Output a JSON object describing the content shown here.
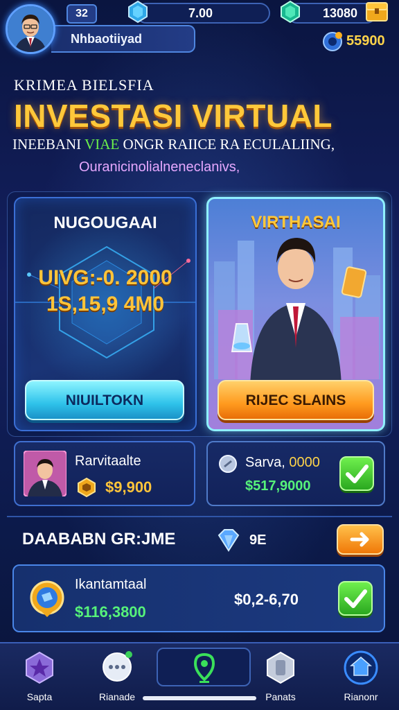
{
  "player": {
    "name": "Nhbaotiiyad",
    "level": "32"
  },
  "resources": {
    "energy_value": "7.00",
    "gem_value": "13080",
    "coin_value": "55900"
  },
  "headline": {
    "kicker": "KRIMEA BIELSFIA",
    "title": "INVESTASI VIRTUAL",
    "sub1_before": "INEEBANI",
    "sub1_highlight": "VIAE",
    "sub1_after": "ONGR RAIICE RA ECULALIING,",
    "sub2": "Ouranicinolialneneclanivs,"
  },
  "card_left": {
    "title": "NUGOUGAAI",
    "line1": "UIVG:-0. 2000",
    "line2": "1S,15,9 4M0",
    "button": "NIUILTOKN"
  },
  "card_right": {
    "title": "VIRTHASAI",
    "button": "RIJEC SLAINS"
  },
  "private_panel": {
    "label": "Rarvitaalte",
    "amount": "$9,900"
  },
  "sale_panel": {
    "label": "Sarva,",
    "label_value": "0000",
    "amount": "$517,9000"
  },
  "section": {
    "title": "DAABABN GR:JME",
    "tag": "9E"
  },
  "investment_row": {
    "name": "Ikantamtaal",
    "amount_green": "$116,3800",
    "amount_white": "$0,2-6,70"
  },
  "nav": [
    {
      "label": "Sapta",
      "icon": "star-badge-icon"
    },
    {
      "label": "Rianade",
      "icon": "chat-bubble-icon"
    },
    {
      "label": "",
      "icon": "location-pin-icon"
    },
    {
      "label": "Panats",
      "icon": "shield-icon"
    },
    {
      "label": "Rianonr",
      "icon": "home-icon"
    }
  ],
  "colors": {
    "title_gold": "#ffc83a",
    "accent_cyan": "#2ec2ea",
    "accent_orange": "#ff9a1e",
    "success_green": "#56f27a",
    "panel_border": "#3f6fd0"
  }
}
